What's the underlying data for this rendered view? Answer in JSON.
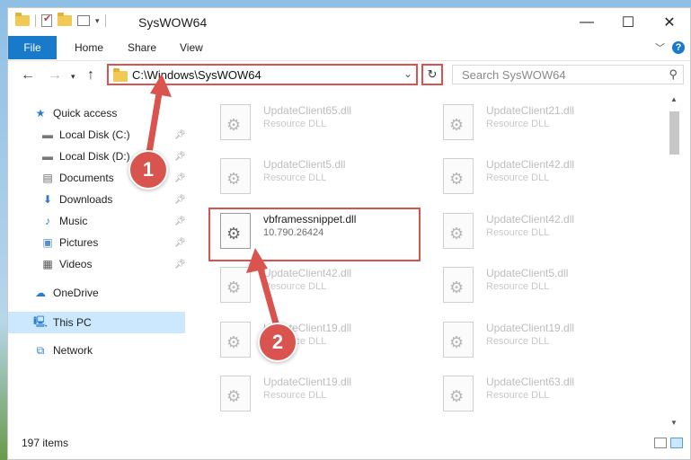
{
  "window": {
    "title": "SysWOW64",
    "minimize": "—",
    "maximize": "☐",
    "close": "✕"
  },
  "ribbon": {
    "file_tab": "File",
    "tabs": [
      "Home",
      "Share",
      "View"
    ],
    "help": "?"
  },
  "address": {
    "path": "C:\\Windows\\SysWOW64",
    "search_placeholder": "Search SysWOW64"
  },
  "nav_pane": {
    "items": [
      {
        "label": "Quick access",
        "icon": "star-icon"
      },
      {
        "label": "Local Disk (C:)",
        "icon": "drive-icon"
      },
      {
        "label": "Local Disk (D:)",
        "icon": "drive-icon"
      },
      {
        "label": "Documents",
        "icon": "documents-icon"
      },
      {
        "label": "Downloads",
        "icon": "download-icon"
      },
      {
        "label": "Music",
        "icon": "music-icon"
      },
      {
        "label": "Pictures",
        "icon": "pictures-icon"
      },
      {
        "label": "Videos",
        "icon": "videos-icon"
      },
      {
        "label": "OneDrive",
        "icon": "cloud-icon"
      },
      {
        "label": "This PC",
        "icon": "computer-icon"
      },
      {
        "label": "Network",
        "icon": "network-icon"
      }
    ]
  },
  "files": [
    {
      "name": "UpdateClient65.dll",
      "desc": "Resource DLL"
    },
    {
      "name": "UpdateClient21.dll",
      "desc": "Resource DLL"
    },
    {
      "name": "UpdateClient5.dll",
      "desc": "Resource DLL"
    },
    {
      "name": "UpdateClient42.dll",
      "desc": "Resource DLL"
    },
    {
      "name": "vbframessnippet.dll",
      "desc": "10.790.26424"
    },
    {
      "name": "UpdateClient42.dll",
      "desc": "Resource DLL"
    },
    {
      "name": "UpdateClient42.dll",
      "desc": "Resource DLL"
    },
    {
      "name": "UpdateClient5.dll",
      "desc": "Resource DLL"
    },
    {
      "name": "UpdateClient19.dll",
      "desc": "Resource DLL"
    },
    {
      "name": "UpdateClient19.dll",
      "desc": "Resource DLL"
    },
    {
      "name": "UpdateClient19.dll",
      "desc": "Resource DLL"
    },
    {
      "name": "UpdateClient63.dll",
      "desc": "Resource DLL"
    }
  ],
  "status": {
    "item_count": "197 items"
  },
  "annotations": {
    "step1": "1",
    "step2": "2",
    "color": "#d9534f"
  }
}
